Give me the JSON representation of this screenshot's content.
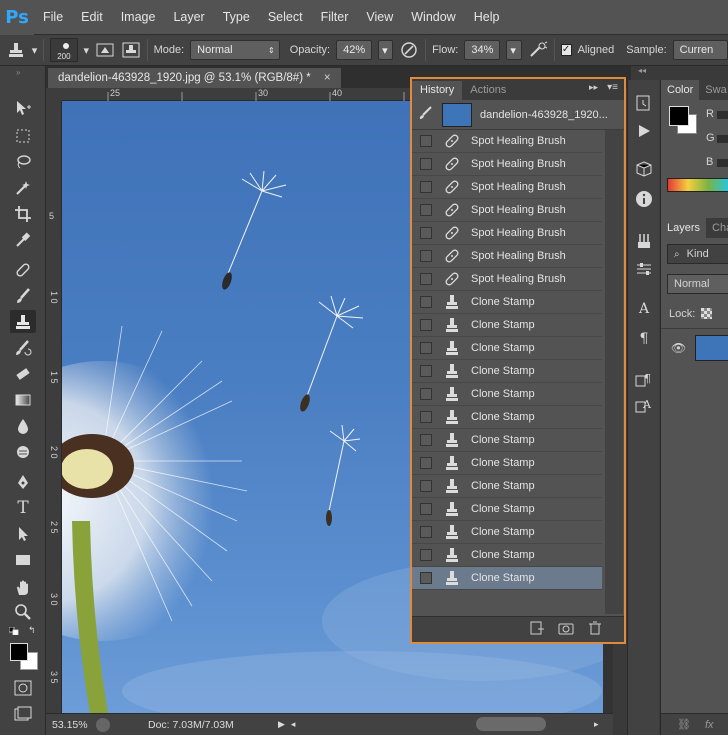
{
  "app": {
    "logo": "Ps"
  },
  "menu": [
    "File",
    "Edit",
    "Image",
    "Layer",
    "Type",
    "Select",
    "Filter",
    "View",
    "Window",
    "Help"
  ],
  "options": {
    "brush_size": "200",
    "mode_label": "Mode:",
    "mode_value": "Normal",
    "opacity_label": "Opacity:",
    "opacity_value": "42%",
    "flow_label": "Flow:",
    "flow_value": "34%",
    "aligned_label": "Aligned",
    "aligned_checked": true,
    "sample_label": "Sample:",
    "sample_value": "Curren"
  },
  "document": {
    "tab_title": "dandelion-463928_1920.jpg @ 53.1% (RGB/8#) *",
    "close_glyph": "×",
    "ruler_h": [
      "25",
      "30",
      "35",
      "40"
    ],
    "ruler_v": [
      "5",
      "1 0",
      "1 5",
      "2 0",
      "2 5",
      "3 0",
      "3 5"
    ]
  },
  "status": {
    "zoom": "53.15%",
    "doc_info": "Doc: 7.03M/7.03M"
  },
  "history": {
    "tabs": [
      "History",
      "Actions"
    ],
    "snapshot_name": "dandelion-463928_1920...",
    "steps": [
      {
        "label": "Spot Healing Brush",
        "icon": "spot-healing-icon"
      },
      {
        "label": "Spot Healing Brush",
        "icon": "spot-healing-icon"
      },
      {
        "label": "Spot Healing Brush",
        "icon": "spot-healing-icon"
      },
      {
        "label": "Spot Healing Brush",
        "icon": "spot-healing-icon"
      },
      {
        "label": "Spot Healing Brush",
        "icon": "spot-healing-icon"
      },
      {
        "label": "Spot Healing Brush",
        "icon": "spot-healing-icon"
      },
      {
        "label": "Spot Healing Brush",
        "icon": "spot-healing-icon"
      },
      {
        "label": "Clone Stamp",
        "icon": "clone-stamp-icon"
      },
      {
        "label": "Clone Stamp",
        "icon": "clone-stamp-icon"
      },
      {
        "label": "Clone Stamp",
        "icon": "clone-stamp-icon"
      },
      {
        "label": "Clone Stamp",
        "icon": "clone-stamp-icon"
      },
      {
        "label": "Clone Stamp",
        "icon": "clone-stamp-icon"
      },
      {
        "label": "Clone Stamp",
        "icon": "clone-stamp-icon"
      },
      {
        "label": "Clone Stamp",
        "icon": "clone-stamp-icon"
      },
      {
        "label": "Clone Stamp",
        "icon": "clone-stamp-icon"
      },
      {
        "label": "Clone Stamp",
        "icon": "clone-stamp-icon"
      },
      {
        "label": "Clone Stamp",
        "icon": "clone-stamp-icon"
      },
      {
        "label": "Clone Stamp",
        "icon": "clone-stamp-icon"
      },
      {
        "label": "Clone Stamp",
        "icon": "clone-stamp-icon"
      },
      {
        "label": "Clone Stamp",
        "icon": "clone-stamp-icon",
        "selected": true
      }
    ]
  },
  "right_panels": {
    "color_tabs": [
      "Color",
      "Swa"
    ],
    "channels": [
      "R",
      "G",
      "B"
    ],
    "layers_tabs": [
      "Layers",
      "Cha"
    ],
    "kind_label": "Kind",
    "blend_mode": "Normal",
    "lock_label": "Lock:"
  },
  "colors": {
    "accent_highlight": "#e08a3c",
    "ps_logo": "#31a8ff",
    "selected_row": "#6b7a8c",
    "sky": "#4a7ec2"
  }
}
